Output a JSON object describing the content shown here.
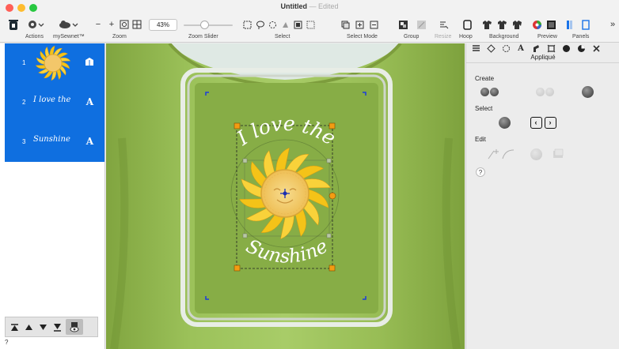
{
  "window": {
    "title": "Untitled",
    "status": "— Edited"
  },
  "toolbar": {
    "groups": [
      {
        "label": "Actions"
      },
      {
        "label": "mySewnet™"
      },
      {
        "label": "Zoom"
      },
      {
        "label": "Zoom Slider"
      },
      {
        "label": "Select"
      },
      {
        "label": "Select Mode"
      },
      {
        "label": "Group"
      },
      {
        "label": "Resize"
      },
      {
        "label": "Hoop"
      },
      {
        "label": "Background"
      },
      {
        "label": "Preview"
      },
      {
        "label": "Panels"
      }
    ],
    "zoom_value": "43%",
    "zoom_out": "−",
    "zoom_in": "+",
    "overflow": "»"
  },
  "objects": [
    {
      "num": "1",
      "kind_icon": "applique-icon",
      "thumb": "sun-icon"
    },
    {
      "num": "2",
      "thumb_text": "I love the",
      "kind": "A"
    },
    {
      "num": "3",
      "thumb_text": "Sunshine",
      "kind": "A"
    }
  ],
  "order_buttons": [
    "▲",
    "▲",
    "▼",
    "▼"
  ],
  "left_help": "?",
  "design": {
    "text_top": "I love the",
    "text_bottom": "Sunshine"
  },
  "panel": {
    "title": "Appliqué",
    "sections": {
      "create": "Create",
      "select": "Select",
      "edit": "Edit"
    },
    "help": "?",
    "tab_text": "A"
  },
  "colors": {
    "accent": "#0f6fe0",
    "shirt": "#93b84f",
    "sun_rays": "#f4c318",
    "sun_face": "#f3c76a",
    "handles": "#f39c12"
  }
}
